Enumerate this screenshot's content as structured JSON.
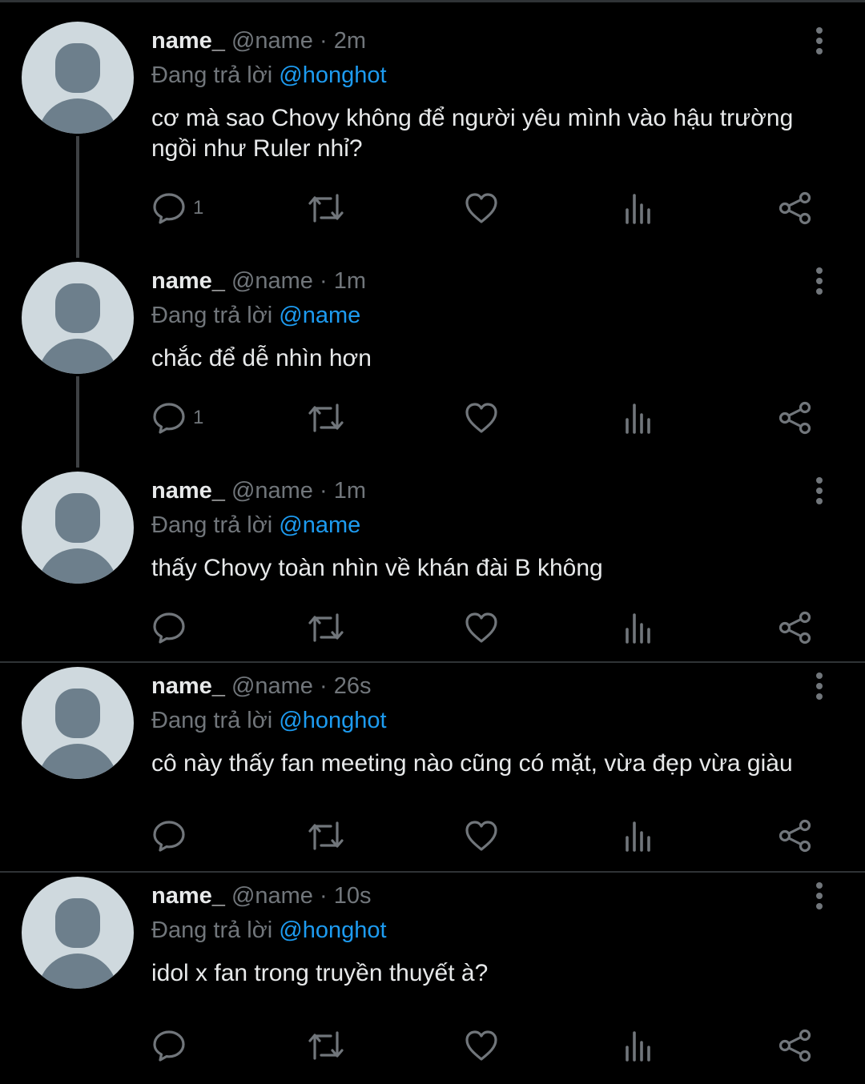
{
  "colors": {
    "background": "#000000",
    "text_primary": "#e7e9ea",
    "text_secondary": "#71767b",
    "mention": "#1d9bf0",
    "divider": "#2f3336",
    "avatar_bg": "#cfd9de",
    "avatar_fg": "#6d7f8c"
  },
  "icons": {
    "more": "more-vertical-icon",
    "reply": "reply-bubble-icon",
    "retweet": "retweet-icon",
    "like": "heart-icon",
    "views": "views-chart-icon",
    "share": "share-icon"
  },
  "tweets": [
    {
      "display_name": "name_",
      "handle_time": " @name · 2m",
      "replying_prefix": "Đang trả lời ",
      "replying_to": "@honghot",
      "text": "cơ mà sao Chovy không để người yêu mình vào hậu trường ngồi như Ruler nhỉ?",
      "reply_count": "1"
    },
    {
      "display_name": "name_",
      "handle_time": " @name · 1m",
      "replying_prefix": "Đang trả lời ",
      "replying_to": "@name",
      "text": "chắc để dễ nhìn hơn",
      "reply_count": "1"
    },
    {
      "display_name": "name_",
      "handle_time": " @name · 1m",
      "replying_prefix": "Đang trả lời ",
      "replying_to": "@name",
      "text": "thấy Chovy toàn nhìn về khán đài B không",
      "reply_count": ""
    },
    {
      "display_name": "name_",
      "handle_time": " @name · 26s",
      "replying_prefix": "Đang trả lời ",
      "replying_to": "@honghot",
      "text": "cô này thấy fan meeting nào cũng có mặt, vừa đẹp vừa giàu",
      "reply_count": ""
    },
    {
      "display_name": "name_",
      "handle_time": " @name · 10s",
      "replying_prefix": "Đang trả lời ",
      "replying_to": "@honghot",
      "text": "idol x fan trong truyền thuyết à?",
      "reply_count": ""
    }
  ]
}
